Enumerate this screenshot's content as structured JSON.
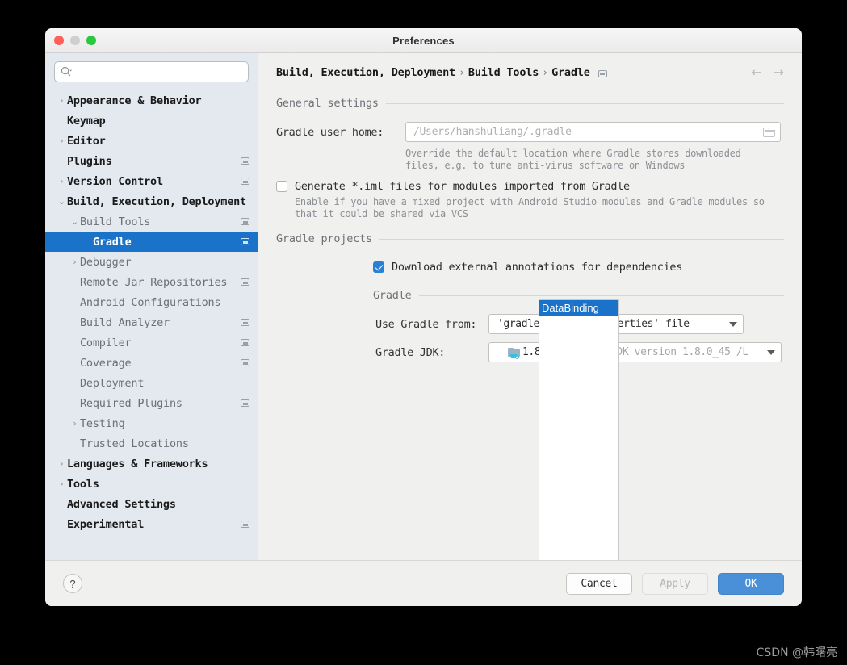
{
  "window": {
    "title": "Preferences"
  },
  "traffic_lights": [
    "close",
    "minimize",
    "zoom"
  ],
  "search": {
    "placeholder": "",
    "value": ""
  },
  "sidebar": {
    "items": [
      {
        "label": "Appearance & Behavior",
        "level": 0,
        "arrow": "›",
        "badge": false,
        "bold": true,
        "selected": false
      },
      {
        "label": "Keymap",
        "level": 0,
        "arrow": "",
        "badge": false,
        "bold": true,
        "selected": false
      },
      {
        "label": "Editor",
        "level": 0,
        "arrow": "›",
        "badge": false,
        "bold": true,
        "selected": false
      },
      {
        "label": "Plugins",
        "level": 0,
        "arrow": "",
        "badge": true,
        "bold": true,
        "selected": false
      },
      {
        "label": "Version Control",
        "level": 0,
        "arrow": "›",
        "badge": true,
        "bold": true,
        "selected": false
      },
      {
        "label": "Build, Execution, Deployment",
        "level": 0,
        "arrow": "⌄",
        "badge": false,
        "bold": true,
        "selected": false
      },
      {
        "label": "Build Tools",
        "level": 1,
        "arrow": "⌄",
        "badge": true,
        "bold": false,
        "selected": false
      },
      {
        "label": "Gradle",
        "level": 2,
        "arrow": "",
        "badge": true,
        "bold": false,
        "selected": true
      },
      {
        "label": "Debugger",
        "level": 1,
        "arrow": "›",
        "badge": false,
        "bold": false,
        "selected": false
      },
      {
        "label": "Remote Jar Repositories",
        "level": 1,
        "arrow": "",
        "badge": true,
        "bold": false,
        "selected": false
      },
      {
        "label": "Android Configurations",
        "level": 1,
        "arrow": "",
        "badge": false,
        "bold": false,
        "selected": false
      },
      {
        "label": "Build Analyzer",
        "level": 1,
        "arrow": "",
        "badge": true,
        "bold": false,
        "selected": false
      },
      {
        "label": "Compiler",
        "level": 1,
        "arrow": "",
        "badge": true,
        "bold": false,
        "selected": false
      },
      {
        "label": "Coverage",
        "level": 1,
        "arrow": "",
        "badge": true,
        "bold": false,
        "selected": false
      },
      {
        "label": "Deployment",
        "level": 1,
        "arrow": "",
        "badge": false,
        "bold": false,
        "selected": false
      },
      {
        "label": "Required Plugins",
        "level": 1,
        "arrow": "",
        "badge": true,
        "bold": false,
        "selected": false
      },
      {
        "label": "Testing",
        "level": 1,
        "arrow": "›",
        "badge": false,
        "bold": false,
        "selected": false
      },
      {
        "label": "Trusted Locations",
        "level": 1,
        "arrow": "",
        "badge": false,
        "bold": false,
        "selected": false
      },
      {
        "label": "Languages & Frameworks",
        "level": 0,
        "arrow": "›",
        "badge": false,
        "bold": true,
        "selected": false
      },
      {
        "label": "Tools",
        "level": 0,
        "arrow": "›",
        "badge": false,
        "bold": true,
        "selected": false
      },
      {
        "label": "Advanced Settings",
        "level": 0,
        "arrow": "",
        "badge": false,
        "bold": true,
        "selected": false
      },
      {
        "label": "Experimental",
        "level": 0,
        "arrow": "",
        "badge": true,
        "bold": true,
        "selected": false
      }
    ]
  },
  "breadcrumb": {
    "part1": "Build, Execution, Deployment",
    "sep1": "›",
    "part2": "Build Tools",
    "sep2": "›",
    "part3": "Gradle"
  },
  "nav": {
    "back": "←",
    "forward": "→"
  },
  "general_settings": {
    "title": "General settings",
    "gradle_user_home_label": "Gradle user home:",
    "gradle_user_home_placeholder": "/Users/hanshuliang/.gradle",
    "gradle_user_home_value": "",
    "hint_line1": "Override the default location where Gradle stores downloaded",
    "hint_line2": "files, e.g. to tune anti-virus software on Windows",
    "generate_iml_label": "Generate *.iml files for modules imported from Gradle",
    "generate_iml_checked": false,
    "generate_iml_hint1": "Enable if you have a mixed project with Android Studio modules and Gradle modules so",
    "generate_iml_hint2": "that it could be shared via VCS"
  },
  "gradle_projects": {
    "title": "Gradle projects",
    "projects": [
      "DataBinding"
    ],
    "download_annotations_label": "Download external annotations for dependencies",
    "download_annotations_checked": true
  },
  "gradle_section": {
    "title": "Gradle",
    "use_gradle_from_label": "Use Gradle from:",
    "use_gradle_from_value": "'gradle-wrapper.properties' file",
    "gradle_jdk_label": "Gradle JDK:",
    "gradle_jdk_version": "1.8",
    "gradle_jdk_detail": "Oracle OpenJDK version 1.8.0_45 /L"
  },
  "footer": {
    "help": "?",
    "cancel": "Cancel",
    "apply": "Apply",
    "apply_disabled": true,
    "ok": "OK"
  },
  "watermark": {
    "text": "CSDN @韩曙亮"
  },
  "colors": {
    "accent": "#1a73c8",
    "primary_button": "#4a90d9",
    "sidebar_bg": "#e4e8ef",
    "content_bg": "#f0f0ee",
    "checkbox_on": "#2b7fd4"
  }
}
